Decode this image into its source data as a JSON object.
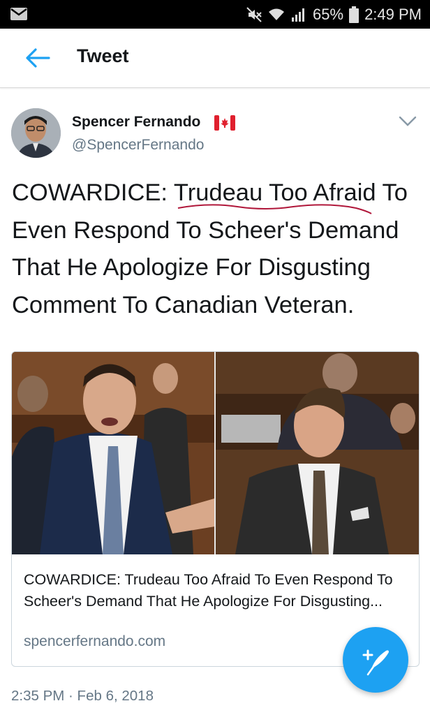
{
  "status_bar": {
    "battery": "65%",
    "time": "2:49 PM"
  },
  "header": {
    "title": "Tweet"
  },
  "tweet": {
    "author_name": "Spencer Fernando",
    "author_handle": "@SpencerFernando",
    "text": "COWARDICE: Trudeau Too Afraid To Even Respond To Scheer's Demand That He Apologize For Disgusting Comment To Canadian Veteran.",
    "timestamp": "2:35 PM · Feb 6, 2018"
  },
  "card": {
    "title": "COWARDICE: Trudeau Too Afraid To Even Respond To Scheer's Demand That He Apologize For Disgusting...",
    "domain": "spencerfernando.com"
  },
  "icons": {
    "back": "arrow-left-icon",
    "caret": "chevron-down-icon",
    "compose": "compose-tweet-icon",
    "flag": "canada-flag-icon"
  },
  "colors": {
    "accent": "#1da1f2",
    "secondary_text": "#657786",
    "annotation": "#b0173a"
  }
}
